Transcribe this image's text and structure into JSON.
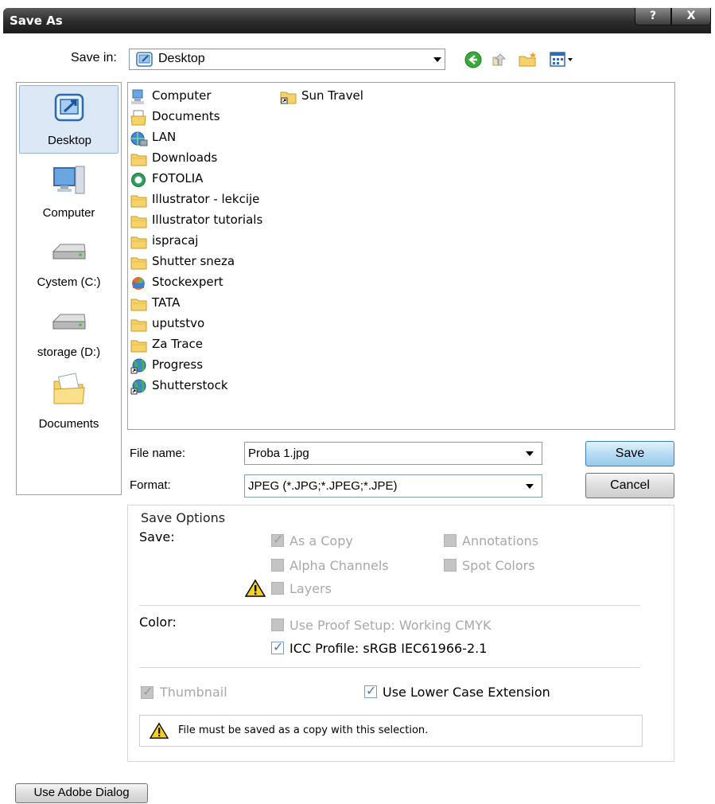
{
  "window": {
    "title": "Save As",
    "help_glyph": "?",
    "close_glyph": "X"
  },
  "save_in": {
    "label": "Save in:",
    "value": "Desktop"
  },
  "places": [
    {
      "label": "Desktop",
      "icon": "desktop-icon",
      "selected": true
    },
    {
      "label": "Computer",
      "icon": "computer-icon"
    },
    {
      "label": "Cystem (C:)",
      "icon": "drive-icon"
    },
    {
      "label": "storage (D:)",
      "icon": "drive-icon"
    },
    {
      "label": "Documents",
      "icon": "documents-folder-icon"
    }
  ],
  "files": [
    {
      "name": "Computer",
      "icon": "computer-icon"
    },
    {
      "name": "Documents",
      "icon": "documents-icon"
    },
    {
      "name": "LAN",
      "icon": "network-icon"
    },
    {
      "name": "Downloads",
      "icon": "folder-icon"
    },
    {
      "name": "FOTOLIA",
      "icon": "web-shortcut-icon"
    },
    {
      "name": "Illustrator - lekcije",
      "icon": "folder-icon"
    },
    {
      "name": "Illustrator tutorials",
      "icon": "folder-icon"
    },
    {
      "name": "ispracaj",
      "icon": "folder-icon"
    },
    {
      "name": "Shutter sneza",
      "icon": "folder-icon"
    },
    {
      "name": "Stockexpert",
      "icon": "app-shortcut-icon"
    },
    {
      "name": "TATA",
      "icon": "folder-icon"
    },
    {
      "name": "uputstvo",
      "icon": "folder-icon"
    },
    {
      "name": "Za Trace",
      "icon": "folder-icon"
    },
    {
      "name": "Progress",
      "icon": "globe-shortcut-icon"
    },
    {
      "name": "Shutterstock",
      "icon": "globe-shortcut-icon"
    },
    {
      "name": "Sun Travel",
      "icon": "shortcut-folder-icon"
    }
  ],
  "file_name": {
    "label": "File name:",
    "value": "Proba 1.jpg"
  },
  "format": {
    "label": "Format:",
    "value": "JPEG (*.JPG;*.JPEG;*.JPE)"
  },
  "buttons": {
    "save": "Save",
    "cancel": "Cancel",
    "use_adobe_dialog": "Use Adobe Dialog"
  },
  "save_options": {
    "title": "Save Options",
    "save_label": "Save:",
    "as_a_copy": {
      "label": "As a Copy",
      "checked": true,
      "enabled": false
    },
    "annotations": {
      "label": "Annotations",
      "checked": false,
      "enabled": false
    },
    "alpha_channels": {
      "label": "Alpha Channels",
      "checked": false,
      "enabled": false
    },
    "spot_colors": {
      "label": "Spot Colors",
      "checked": false,
      "enabled": false
    },
    "layers": {
      "label": "Layers",
      "checked": false,
      "enabled": false
    },
    "color_label": "Color:",
    "use_proof_setup": {
      "label": "Use Proof Setup:  Working CMYK",
      "checked": false,
      "enabled": false
    },
    "icc_profile": {
      "label": "ICC Profile:  sRGB IEC61966-2.1",
      "checked": true,
      "enabled": true
    },
    "thumbnail": {
      "label": "Thumbnail",
      "checked": true,
      "enabled": false
    },
    "lower_case_ext": {
      "label": "Use Lower Case Extension",
      "checked": true,
      "enabled": true
    },
    "warning_message": "File must be saved as a copy with this selection."
  },
  "colors": {
    "titlebar": "#2b2b2b",
    "selection": "#dce8f6",
    "save_button": "#b7dcf3",
    "disabled_text": "#a8a8a8"
  }
}
